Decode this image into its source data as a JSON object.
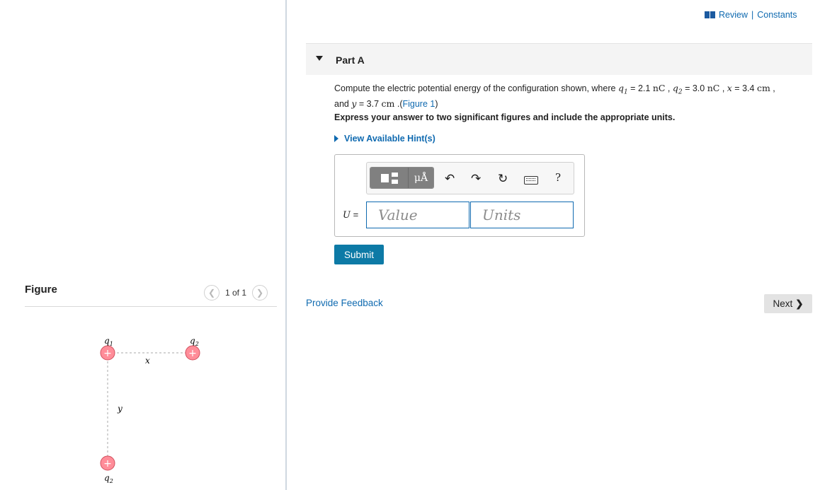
{
  "review": {
    "review_label": "Review",
    "sep": "|",
    "constants_label": "Constants"
  },
  "part": {
    "title": "Part A"
  },
  "question": {
    "intro": "Compute the electric potential energy of the configuration shown, where",
    "q1_sym": "q",
    "q1_sub": "1",
    "q1_eq": " = 2.1 ",
    "q1_unit": "nC",
    "q2_sym": "q",
    "q2_sub": "2",
    "q2_eq": " = 3.0 ",
    "q2_unit": "nC",
    "x_sym": "x",
    "x_eq": " = 3.4 ",
    "x_unit": "cm",
    "and": "and ",
    "y_sym": "y",
    "y_eq": " = 3.7 ",
    "y_unit": "cm",
    "figure_link": "Figure 1"
  },
  "instruction": "Express your answer to two significant figures and include the appropriate units.",
  "hints_label": "View Available Hint(s)",
  "answer": {
    "var": "U",
    "eq": " =",
    "value_placeholder": "Value",
    "units_placeholder": "Units",
    "mu_a_label": "μÅ",
    "help_label": "?"
  },
  "submit_label": "Submit",
  "feedback_label": "Provide Feedback",
  "next_label": "Next",
  "figure": {
    "title": "Figure",
    "pager": "1 of 1",
    "labels": {
      "top_left": "q1",
      "top_right": "q2",
      "bottom": "q2",
      "x": "x",
      "y": "y"
    },
    "charge_color": "#ff8d99",
    "plus": "+"
  }
}
